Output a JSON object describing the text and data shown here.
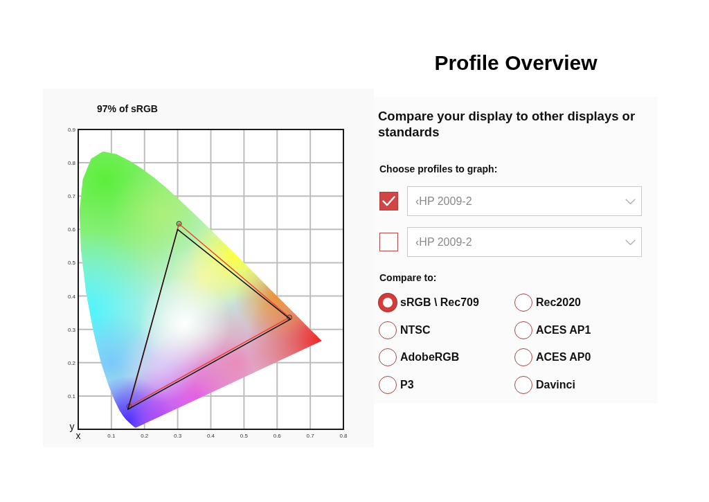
{
  "title": "Profile Overview",
  "gamut_chart": {
    "chart_data": {
      "type": "line",
      "title": "97% of sRGB",
      "xlabel": "x",
      "ylabel": "y",
      "xlim": [
        0,
        0.8
      ],
      "ylim": [
        0,
        0.9
      ],
      "xticks": [
        0.1,
        0.2,
        0.3,
        0.4,
        0.5,
        0.6,
        0.7,
        0.8
      ],
      "yticks": [
        0.1,
        0.2,
        0.3,
        0.4,
        0.5,
        0.6,
        0.7,
        0.8,
        0.9
      ],
      "grid": true,
      "series": [
        {
          "color": "#e8432e",
          "marker": "circle",
          "x": [
            0.154,
            0.304,
            0.637
          ],
          "values": [
            0.069,
            0.617,
            0.336
          ]
        },
        {
          "color": "#e8432e",
          "x": [
            0.154,
            0.637
          ],
          "values": [
            0.069,
            0.336
          ]
        },
        {
          "color": "#111111",
          "x": [
            0.15,
            0.3,
            0.64
          ],
          "values": [
            0.06,
            0.6,
            0.33
          ]
        },
        {
          "color": "#111111",
          "x": [
            0.15,
            0.64
          ],
          "values": [
            0.06,
            0.33
          ]
        }
      ]
    }
  },
  "profiles": {
    "heading": "Compare your display to other displays or standards",
    "label": "Choose profiles to graph:",
    "rows": [
      {
        "checked": true,
        "value": "‹HP 2009-2"
      },
      {
        "checked": false,
        "value": "‹HP 2009-2"
      }
    ]
  },
  "compare": {
    "label": "Compare to:",
    "options": [
      {
        "label": "sRGB \\ Rec709",
        "selected": true
      },
      {
        "label": "Rec2020",
        "selected": false
      },
      {
        "label": "NTSC",
        "selected": false
      },
      {
        "label": "ACES AP1",
        "selected": false
      },
      {
        "label": "AdobeRGB",
        "selected": false
      },
      {
        "label": "ACES AP0",
        "selected": false
      },
      {
        "label": "P3",
        "selected": false
      },
      {
        "label": "Davinci",
        "selected": false
      }
    ]
  }
}
